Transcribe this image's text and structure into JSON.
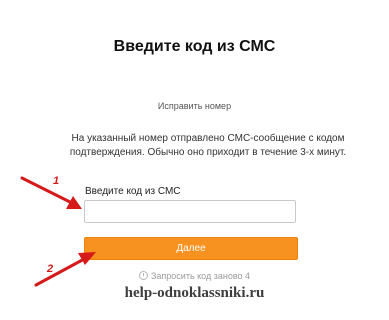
{
  "header": {
    "title": "Введите код из СМС"
  },
  "fix_number_link": "Исправить номер",
  "info_text": "На указанный номер отправлено СМС-сообщение с кодом подтверждения. Обычно оно приходит в течение 3-х минут.",
  "code_field": {
    "label": "Введите код из СМС",
    "value": "",
    "placeholder": ""
  },
  "next_button": {
    "label": "Далее"
  },
  "resend": {
    "text": "Запросить код заново 4"
  },
  "annotations": {
    "arrow1_label": "1",
    "arrow2_label": "2",
    "color": "#d61a1a"
  },
  "watermark": "help-odnoklassniki.ru",
  "colors": {
    "accent": "#f7911f"
  }
}
